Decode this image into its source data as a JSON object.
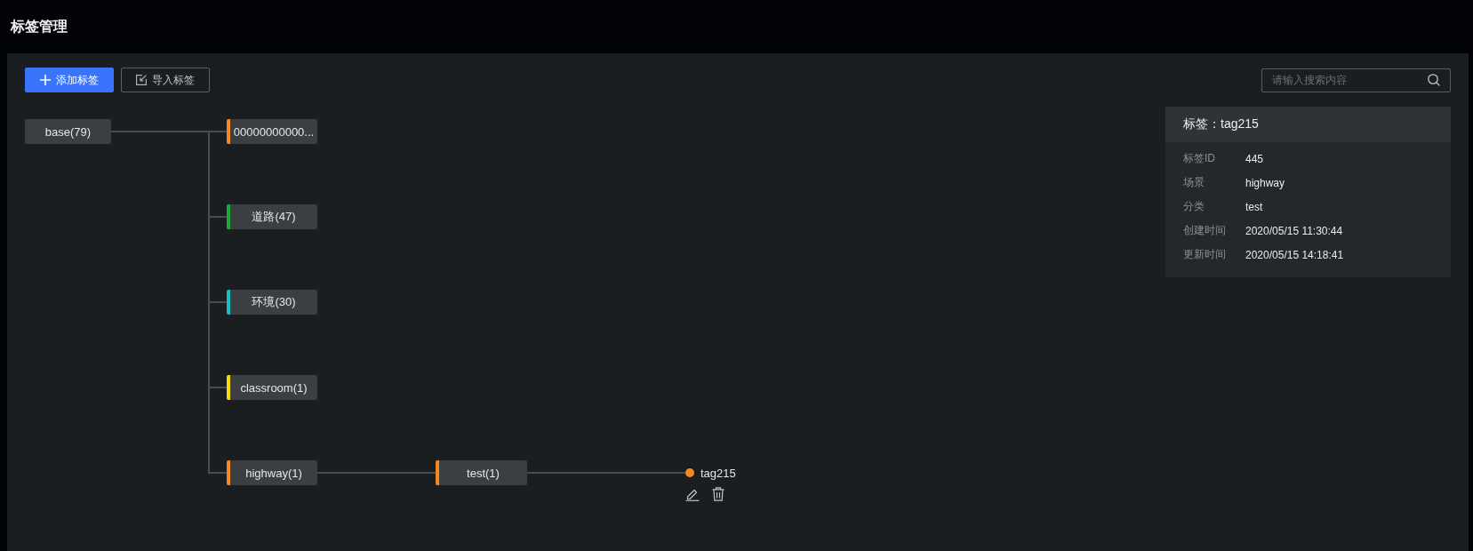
{
  "page_title": "标签管理",
  "toolbar": {
    "buttons": [
      {
        "label": "添加标签",
        "kind": "add"
      },
      {
        "label": "导入标签",
        "kind": "import"
      }
    ],
    "search": {
      "placeholder": "请输入搜索内容"
    }
  },
  "tree": {
    "root": {
      "label": "base(79)",
      "kind": "category",
      "children": [
        {
          "label": "00000000000...",
          "kind": "category",
          "color": "#f5891f"
        },
        {
          "label": "道路(47)",
          "kind": "category",
          "color": "#1fa83a"
        },
        {
          "label": "环境(30)",
          "kind": "category",
          "color": "#17bcc4"
        },
        {
          "label": "classroom(1)",
          "kind": "category",
          "color": "#f5d90a"
        },
        {
          "label": "highway(1)",
          "kind": "category",
          "color": "#f5891f",
          "children": [
            {
              "label": "test(1)",
              "kind": "category",
              "color": "#f5891f",
              "children": [
                {
                  "label": "tag215",
                  "kind": "tag",
                  "color": "#f5891f"
                }
              ]
            }
          ]
        }
      ]
    }
  },
  "detail": {
    "title": "标签：tag215",
    "fields": [
      {
        "label": "标签ID",
        "value": "445"
      },
      {
        "label": "场景",
        "value": "highway"
      },
      {
        "label": "分类",
        "value": "test"
      },
      {
        "label": "创建时间",
        "value": "2020/05/15 11:30:44"
      },
      {
        "label": "更新时间",
        "value": "2020/05/15 14:18:41"
      }
    ]
  }
}
